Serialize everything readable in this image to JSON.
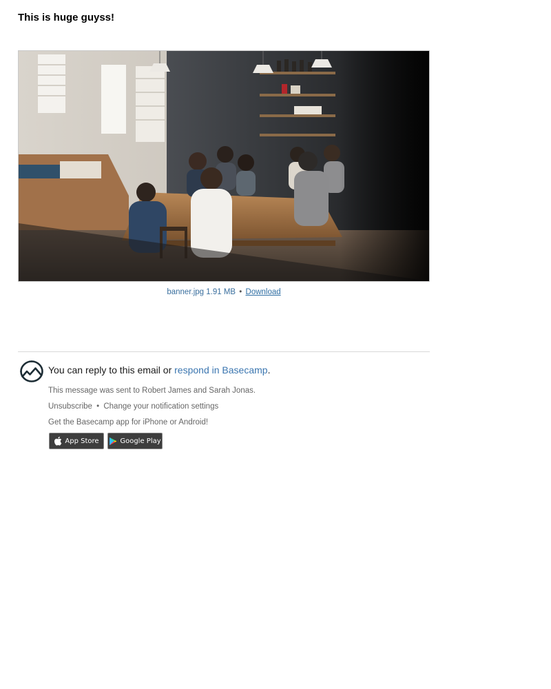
{
  "message": {
    "headline": "This is huge guyss!"
  },
  "attachment": {
    "image_alt": "banner.jpg",
    "filename": "banner.jpg",
    "size": "1.91 MB",
    "separator": "•",
    "download_label": "Download"
  },
  "footer": {
    "logo_icon": "basecamp-logo-icon",
    "reply_prefix": "You can reply to this email or",
    "reply_link": "respond in Basecamp",
    "reply_suffix": ".",
    "sent_to": "This message was sent to Robert James and Sarah Jonas.",
    "unsubscribe": "Unsubscribe",
    "separator": "•",
    "notification_settings": "Change your notification settings",
    "app_prompt": "Get the Basecamp app for iPhone or Android!",
    "app_store_label": "App Store",
    "google_play_label": "Google Play"
  },
  "colors": {
    "link": "#3b76b0",
    "muted_text": "#666666",
    "store_badge": "#3d3d3d"
  }
}
